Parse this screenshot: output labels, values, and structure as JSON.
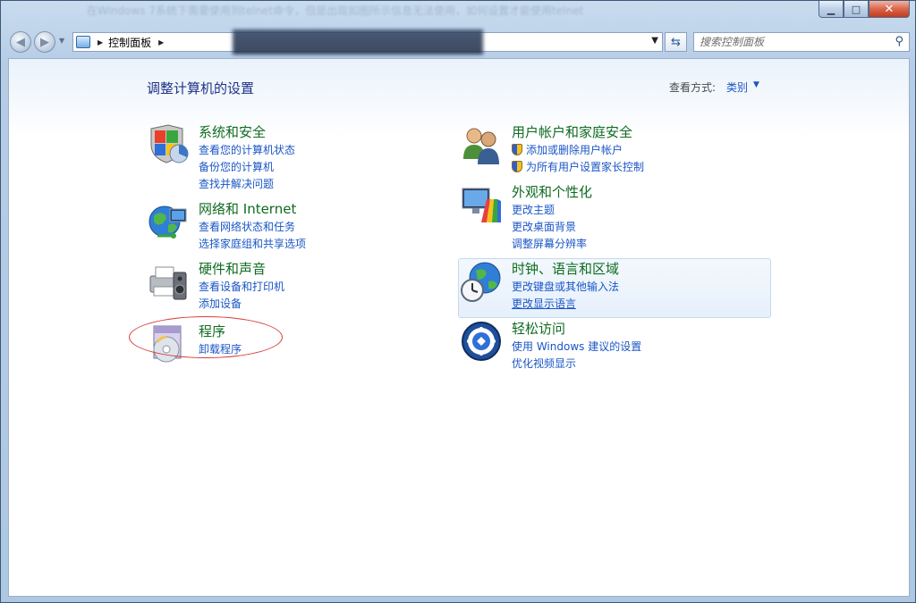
{
  "window": {
    "background_title": "在Windows 7系统下需要使用到telnet命令，但是出现如图所示信息无法使用，如何设置才能使用telnet"
  },
  "caption": {
    "minimize": "▁",
    "maximize": "□",
    "close": "✕"
  },
  "nav": {
    "breadcrumb": "控制面板",
    "search_placeholder": "搜索控制面板"
  },
  "header": {
    "title": "调整计算机的设置",
    "view_by_label": "查看方式:",
    "view_by_value": "类别"
  },
  "categories": [
    {
      "title": "系统和安全",
      "links": [
        "查看您的计算机状态",
        "备份您的计算机",
        "查找并解决问题"
      ]
    },
    {
      "title": "网络和 Internet",
      "links": [
        "查看网络状态和任务",
        "选择家庭组和共享选项"
      ]
    },
    {
      "title": "硬件和声音",
      "links": [
        "查看设备和打印机",
        "添加设备"
      ]
    },
    {
      "title": "程序",
      "links": [
        "卸载程序"
      ]
    },
    {
      "title": "用户帐户和家庭安全",
      "links": [
        "添加或删除用户帐户",
        "为所有用户设置家长控制"
      ]
    },
    {
      "title": "外观和个性化",
      "links": [
        "更改主题",
        "更改桌面背景",
        "调整屏幕分辨率"
      ]
    },
    {
      "title": "时钟、语言和区域",
      "links": [
        "更改键盘或其他输入法",
        "更改显示语言"
      ]
    },
    {
      "title": "轻松访问",
      "links": [
        "使用 Windows 建议的设置",
        "优化视频显示"
      ]
    }
  ],
  "colors": {
    "category_title": "#0f6b21",
    "link": "#1a56c6",
    "page_title": "#1e3287",
    "annotation": "#d63b3b"
  }
}
